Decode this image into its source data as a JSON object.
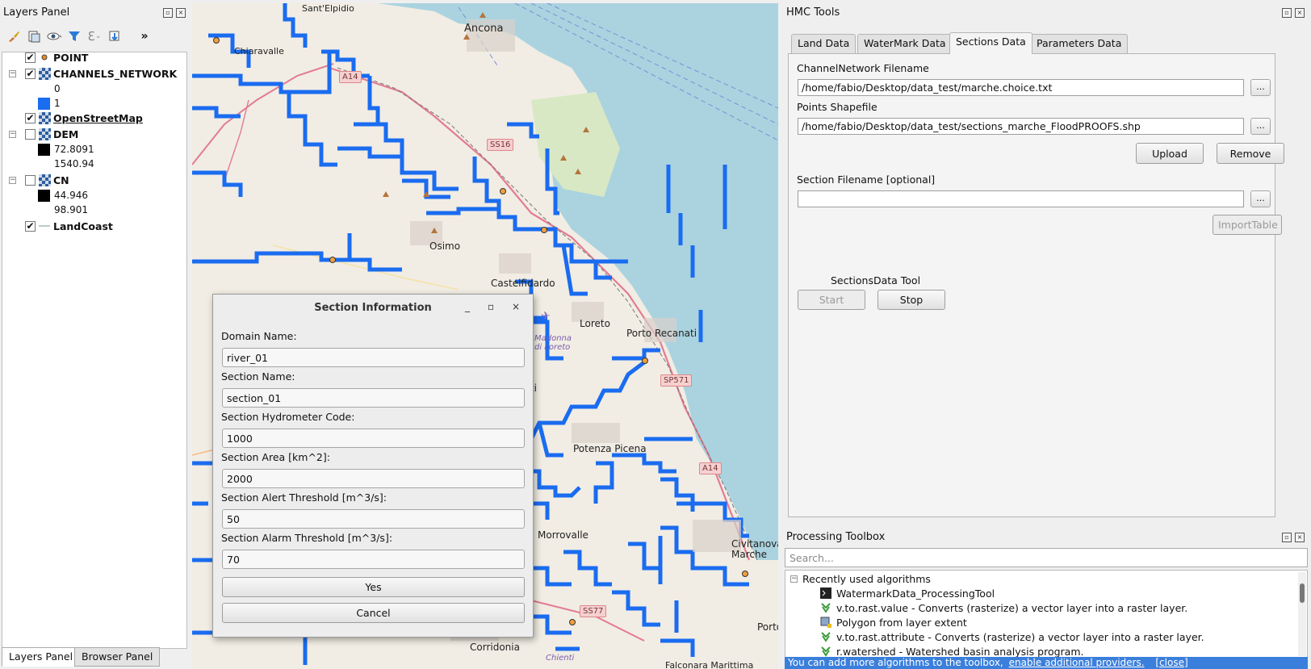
{
  "layers_panel": {
    "title": "Layers Panel",
    "layers": [
      {
        "name": "POINT",
        "checked": true,
        "kind": "point"
      },
      {
        "name": "CHANNELS_NETWORK",
        "checked": true,
        "kind": "raster",
        "legend": [
          {
            "label": "0",
            "color": ""
          },
          {
            "label": "1",
            "color": "#1a6cf0"
          }
        ]
      },
      {
        "name": "OpenStreetMap",
        "checked": true,
        "kind": "raster"
      },
      {
        "name": "DEM",
        "checked": false,
        "kind": "raster",
        "legend": [
          {
            "label": "72.8091",
            "color": "#000000"
          },
          {
            "label": "1540.94",
            "color": ""
          }
        ]
      },
      {
        "name": "CN",
        "checked": false,
        "kind": "raster",
        "legend": [
          {
            "label": "44.946",
            "color": "#000000"
          },
          {
            "label": "98.901",
            "color": ""
          }
        ]
      },
      {
        "name": "LandCoast",
        "checked": true,
        "kind": "line"
      }
    ],
    "bottom_tabs": [
      "Layers Panel",
      "Browser Panel"
    ]
  },
  "map": {
    "labels": [
      "Ancona",
      "Chiaravalle",
      "Osimo",
      "Castelfidardo",
      "Loreto",
      "Porto Recanati",
      "Potenza Picena",
      "Morrovalle",
      "Civitanova Marche",
      "Corridonia",
      "Sant'Elpidio",
      "Falconara Marittima",
      "Madonna di Loreto",
      "nati",
      "Porto",
      "Chienti"
    ],
    "road_shields": [
      "A14",
      "SS16",
      "SP571",
      "A14",
      "SS77"
    ],
    "colors": {
      "network": "#1a6cf0",
      "sea": "#aad3df",
      "land": "#f1ede4"
    }
  },
  "section_dialog": {
    "title": "Section Information",
    "controls": [
      "_",
      "▫",
      "×"
    ],
    "fields": [
      {
        "label": "Domain Name:",
        "value": "river_01"
      },
      {
        "label": "Section Name:",
        "value": "section_01"
      },
      {
        "label": "Section Hydrometer Code:",
        "value": "1000"
      },
      {
        "label": "Section Area [km^2]:",
        "value": "2000"
      },
      {
        "label": "Section Alert Threshold [m^3/s]:",
        "value": "50"
      },
      {
        "label": "Section Alarm Threshold [m^3/s]:",
        "value": "70"
      }
    ],
    "yes_label": "Yes",
    "cancel_label": "Cancel"
  },
  "hmc_tools": {
    "title": "HMC Tools",
    "tabs": [
      "Land Data",
      "WaterMark Data",
      "Sections Data",
      "Parameters Data"
    ],
    "active_tab": "Sections Data",
    "channel_label": "ChannelNetwork Filename",
    "channel_value": "/home/fabio/Desktop/data_test/marche.choice.txt",
    "points_label": "Points Shapefile",
    "points_value": "/home/fabio/Desktop/data_test/sections_marche_FloodPROOFS.shp",
    "upload_label": "Upload",
    "remove_label": "Remove",
    "section_file_label": "Section Filename [optional]",
    "section_file_value": "",
    "browse_label": "...",
    "import_label": "ImportTable",
    "tool_label": "SectionsData Tool",
    "start_label": "Start",
    "stop_label": "Stop"
  },
  "processing_toolbox": {
    "title": "Processing Toolbox",
    "search_placeholder": "Search...",
    "group": "Recently used algorithms",
    "items": [
      {
        "icon": "terminal-icon",
        "label": "WatermarkData_ProcessingTool"
      },
      {
        "icon": "grass-icon",
        "label": "v.to.rast.value - Converts (rasterize) a vector layer into a raster layer."
      },
      {
        "icon": "polygon-icon",
        "label": "Polygon from layer extent"
      },
      {
        "icon": "grass-icon",
        "label": "v.to.rast.attribute - Converts (rasterize) a vector layer into a raster layer."
      },
      {
        "icon": "grass-icon",
        "label": "r.watershed - Watershed basin analysis program."
      }
    ],
    "status_text": "You can add more algorithms to the toolbox,",
    "status_link": "enable additional providers.",
    "status_close": "[close]"
  }
}
